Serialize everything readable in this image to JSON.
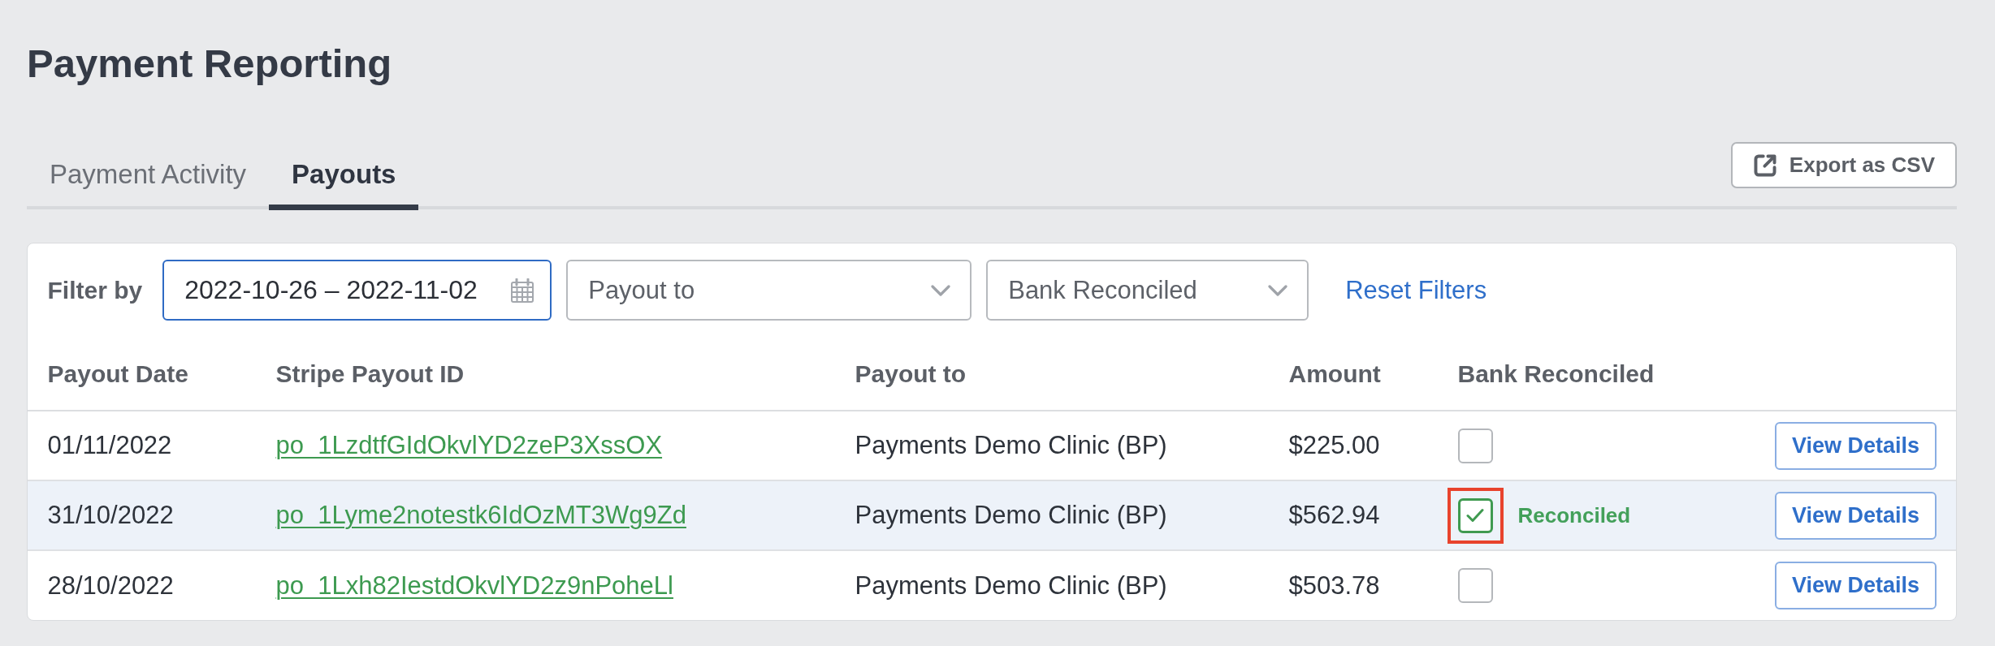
{
  "page": {
    "title": "Payment Reporting"
  },
  "tabs": [
    {
      "label": "Payment Activity",
      "selected": false
    },
    {
      "label": "Payouts",
      "selected": true
    }
  ],
  "export_button": {
    "label": "Export as CSV"
  },
  "filters": {
    "label": "Filter by",
    "fields": [
      {
        "kind": "date-range",
        "value": "2022-10-26 – 2022-11-02",
        "focused": true
      },
      {
        "kind": "select",
        "placeholder": "Payout to",
        "focused": false
      },
      {
        "kind": "select",
        "placeholder": "Bank Reconciled",
        "focused": false
      }
    ],
    "reset_link": "Reset Filters"
  },
  "table": {
    "columns": [
      "Payout Date",
      "Stripe Payout ID",
      "Payout to",
      "Amount",
      "Bank Reconciled"
    ],
    "rows": [
      {
        "payout_date": "01/11/2022",
        "payout_id": "po_1LzdtfGIdOkvlYD2zeP3XssOX",
        "payout_to": "Payments Demo Clinic (BP)",
        "amount": "$225.00",
        "reconciled": false,
        "highlighted": false,
        "annotated": false,
        "action": "View Details"
      },
      {
        "payout_date": "31/10/2022",
        "payout_id": "po_1Lyme2notestk6IdOzMT3Wg9Zd",
        "payout_to": "Payments Demo Clinic (BP)",
        "amount": "$562.94",
        "reconciled": true,
        "status": "Reconciled",
        "highlighted": true,
        "annotated": true,
        "action": "View Details"
      },
      {
        "payout_date": "28/10/2022",
        "payout_id": "po_1Lxh82IestdOkvlYD2z9nPoheLl",
        "payout_to": "Payments Demo Clinic (BP)",
        "amount": "$503.78",
        "reconciled": false,
        "highlighted": false,
        "annotated": false,
        "action": "View Details"
      }
    ]
  }
}
